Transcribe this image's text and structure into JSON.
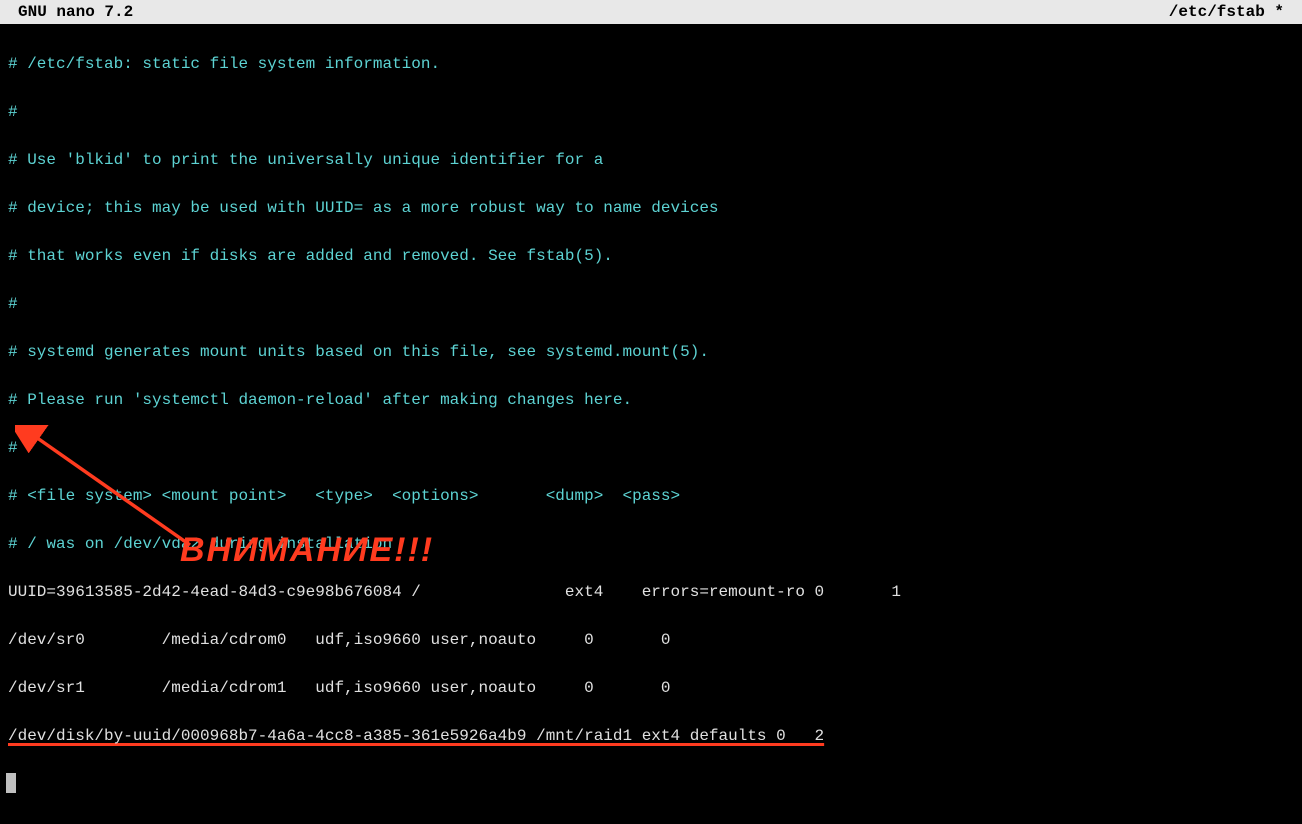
{
  "titlebar": {
    "app": "GNU nano 7.2",
    "file": "/etc/fstab *"
  },
  "lines": {
    "l0": "# /etc/fstab: static file system information.",
    "l1": "#",
    "l2": "# Use 'blkid' to print the universally unique identifier for a",
    "l3": "# device; this may be used with UUID= as a more robust way to name devices",
    "l4": "# that works even if disks are added and removed. See fstab(5).",
    "l5": "#",
    "l6": "# systemd generates mount units based on this file, see systemd.mount(5).",
    "l7": "# Please run 'systemctl daemon-reload' after making changes here.",
    "l8": "#",
    "l9": "# <file system> <mount point>   <type>  <options>       <dump>  <pass>",
    "l10": "# / was on /dev/vda2 during installation",
    "l11": "UUID=39613585-2d42-4ead-84d3-c9e98b676084 /               ext4    errors=remount-ro 0       1",
    "l12": "/dev/sr0        /media/cdrom0   udf,iso9660 user,noauto     0       0",
    "l13": "/dev/sr1        /media/cdrom1   udf,iso9660 user,noauto     0       0",
    "l14": "/dev/disk/by-uuid/000968b7-4a6a-4cc8-a385-361e5926a4b9 /mnt/raid1 ext4 defaults 0   2"
  },
  "annotation": {
    "text": "ВНИМАНИЕ!!!"
  },
  "colors": {
    "comment": "#5dd3d3",
    "normal": "#e0e0e0",
    "underline": "#ff3b1f",
    "annotation": "#ff3b1f",
    "titlebar_bg": "#e8e8e8",
    "titlebar_fg": "#000000",
    "bg": "#000000"
  }
}
